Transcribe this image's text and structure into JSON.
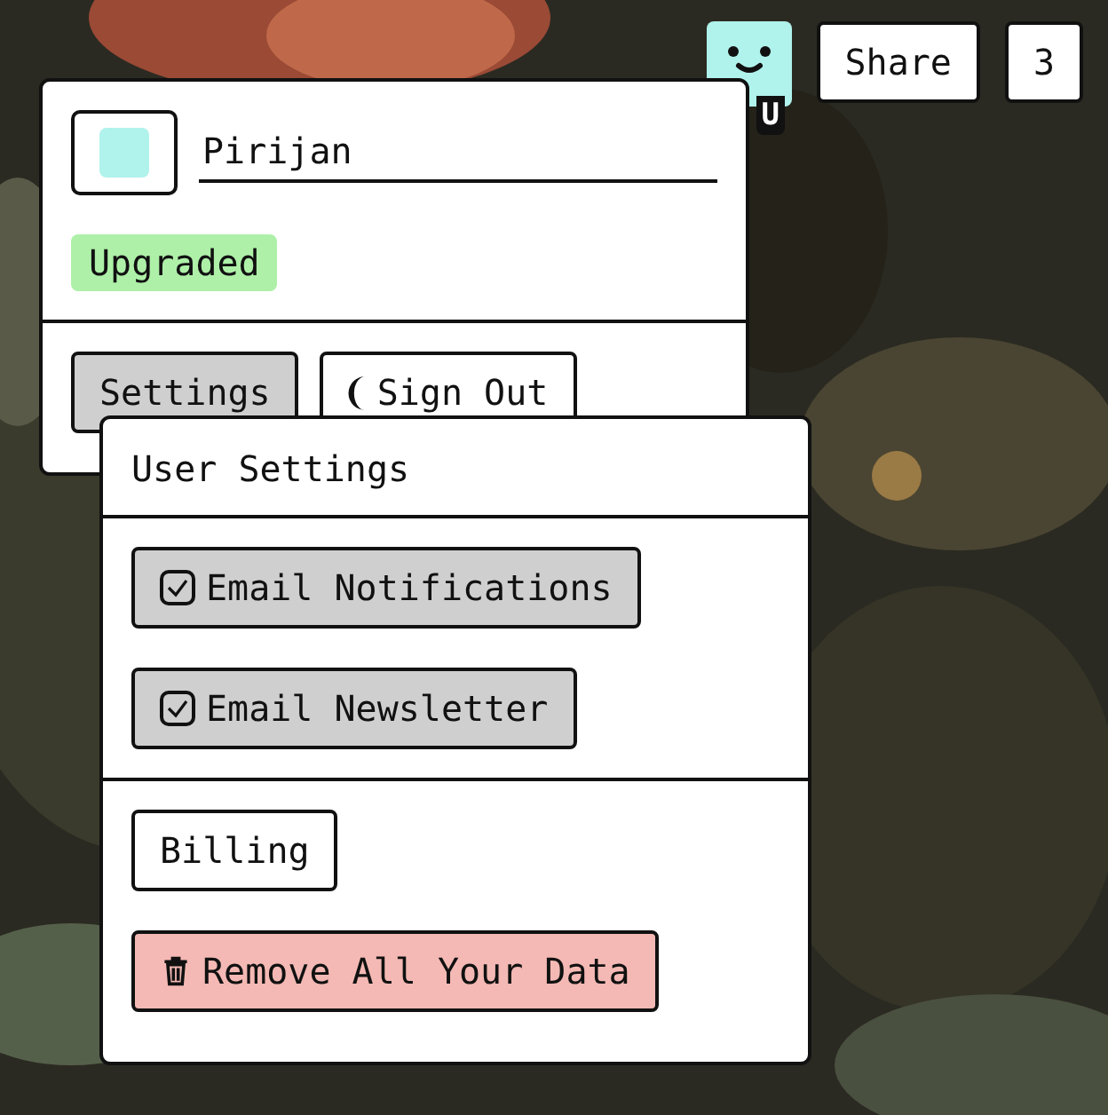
{
  "header": {
    "avatar": {
      "badge": "U"
    },
    "buttons": [
      {
        "label": "Share"
      },
      {
        "label": "3"
      }
    ]
  },
  "user_menu": {
    "color": "#b0f2ec",
    "name": {
      "value": "Pirijan"
    },
    "badge": "Upgraded",
    "buttons": [
      {
        "label": "Settings",
        "kind": "plain",
        "selected": true
      },
      {
        "label": "Sign Out",
        "kind": "moon",
        "selected": false
      }
    ]
  },
  "settings_menu": {
    "title": "User Settings",
    "toggles": [
      {
        "label": "Email Notifications",
        "checked": true
      },
      {
        "label": "Email Newsletter",
        "checked": true
      }
    ],
    "actions": [
      {
        "label": "Billing",
        "kind": "plain"
      },
      {
        "label": "Remove All Your Data",
        "kind": "danger"
      }
    ]
  }
}
